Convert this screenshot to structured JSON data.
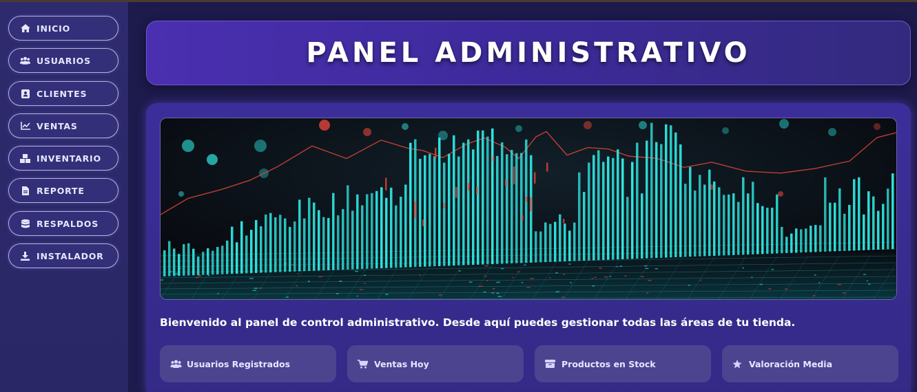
{
  "sidebar": {
    "items": [
      {
        "label": "INICIO",
        "icon": "home-icon"
      },
      {
        "label": "USUARIOS",
        "icon": "users-icon"
      },
      {
        "label": "CLIENTES",
        "icon": "address-book-icon"
      },
      {
        "label": "VENTAS",
        "icon": "chart-line-icon"
      },
      {
        "label": "INVENTARIO",
        "icon": "boxes-icon"
      },
      {
        "label": "REPORTE",
        "icon": "file-icon"
      },
      {
        "label": "RESPALDOS",
        "icon": "database-icon"
      },
      {
        "label": "INSTALADOR",
        "icon": "download-icon"
      }
    ]
  },
  "header": {
    "title": "PANEL ADMINISTRATIVO"
  },
  "main": {
    "welcome": "Bienvenido al panel de control administrativo. Desde aquí puedes gestionar todas las áreas de tu tienda.",
    "stats": [
      {
        "label": "Usuarios Registrados",
        "icon": "users-icon"
      },
      {
        "label": "Ventas Hoy",
        "icon": "cart-icon"
      },
      {
        "label": "Productos en Stock",
        "icon": "box-icon"
      },
      {
        "label": "Valoración Media",
        "icon": "star-icon"
      }
    ]
  },
  "colors": {
    "background": "#1d1a4c",
    "sidebar": "#2e2a6e",
    "header": "#4a2fb0",
    "card": "#3c2e9a",
    "stat": "#4d4490",
    "accent_cyan": "#2ee6e0",
    "accent_red": "#e0453a"
  }
}
